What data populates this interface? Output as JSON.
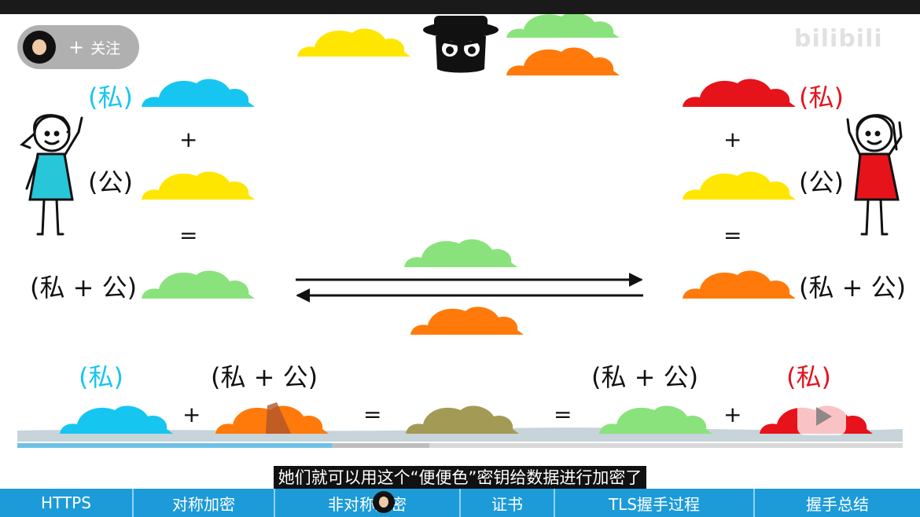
{
  "uploader": {
    "follow_plus": "+",
    "follow_label": "关注"
  },
  "watermark": {
    "brand": "bilibili",
    "tagline": ""
  },
  "labels": {
    "left_private": "(私)",
    "left_plus": "+",
    "left_public": "(公)",
    "left_equals": "=",
    "left_mix": "(私 + 公)",
    "right_private": "(私)",
    "right_plus": "+",
    "right_public": "(公)",
    "right_equals": "=",
    "right_mix": "(私 + 公)",
    "bottom_private_left": "(私)",
    "bottom_mix_left": "(私 + 公)",
    "bottom_plus_1": "+",
    "bottom_equals_1": "=",
    "bottom_equals_2": "=",
    "bottom_mix_right": "(私 + 公)",
    "bottom_plus_2": "+",
    "bottom_private_right": "(私)"
  },
  "colors": {
    "cyan": "#17c6f0",
    "yellow": "#ffe600",
    "green": "#8ae27c",
    "orange": "#ff7a0a",
    "red": "#e6131b",
    "olive": "#a39a56",
    "progress_played": "#6ec1e4",
    "chapter_bar": "#1d9bd8"
  },
  "player": {
    "played_fraction": 0.355,
    "buffered_fraction": 0.465,
    "play_icon": "play-icon"
  },
  "subtitle": "她们就可以用这个“便便色”密钥给数据进行加密了",
  "chapters": [
    "HTTPS",
    "对称加密",
    "非对称加密",
    "证书",
    "TLS握手过程",
    "握手总结"
  ]
}
